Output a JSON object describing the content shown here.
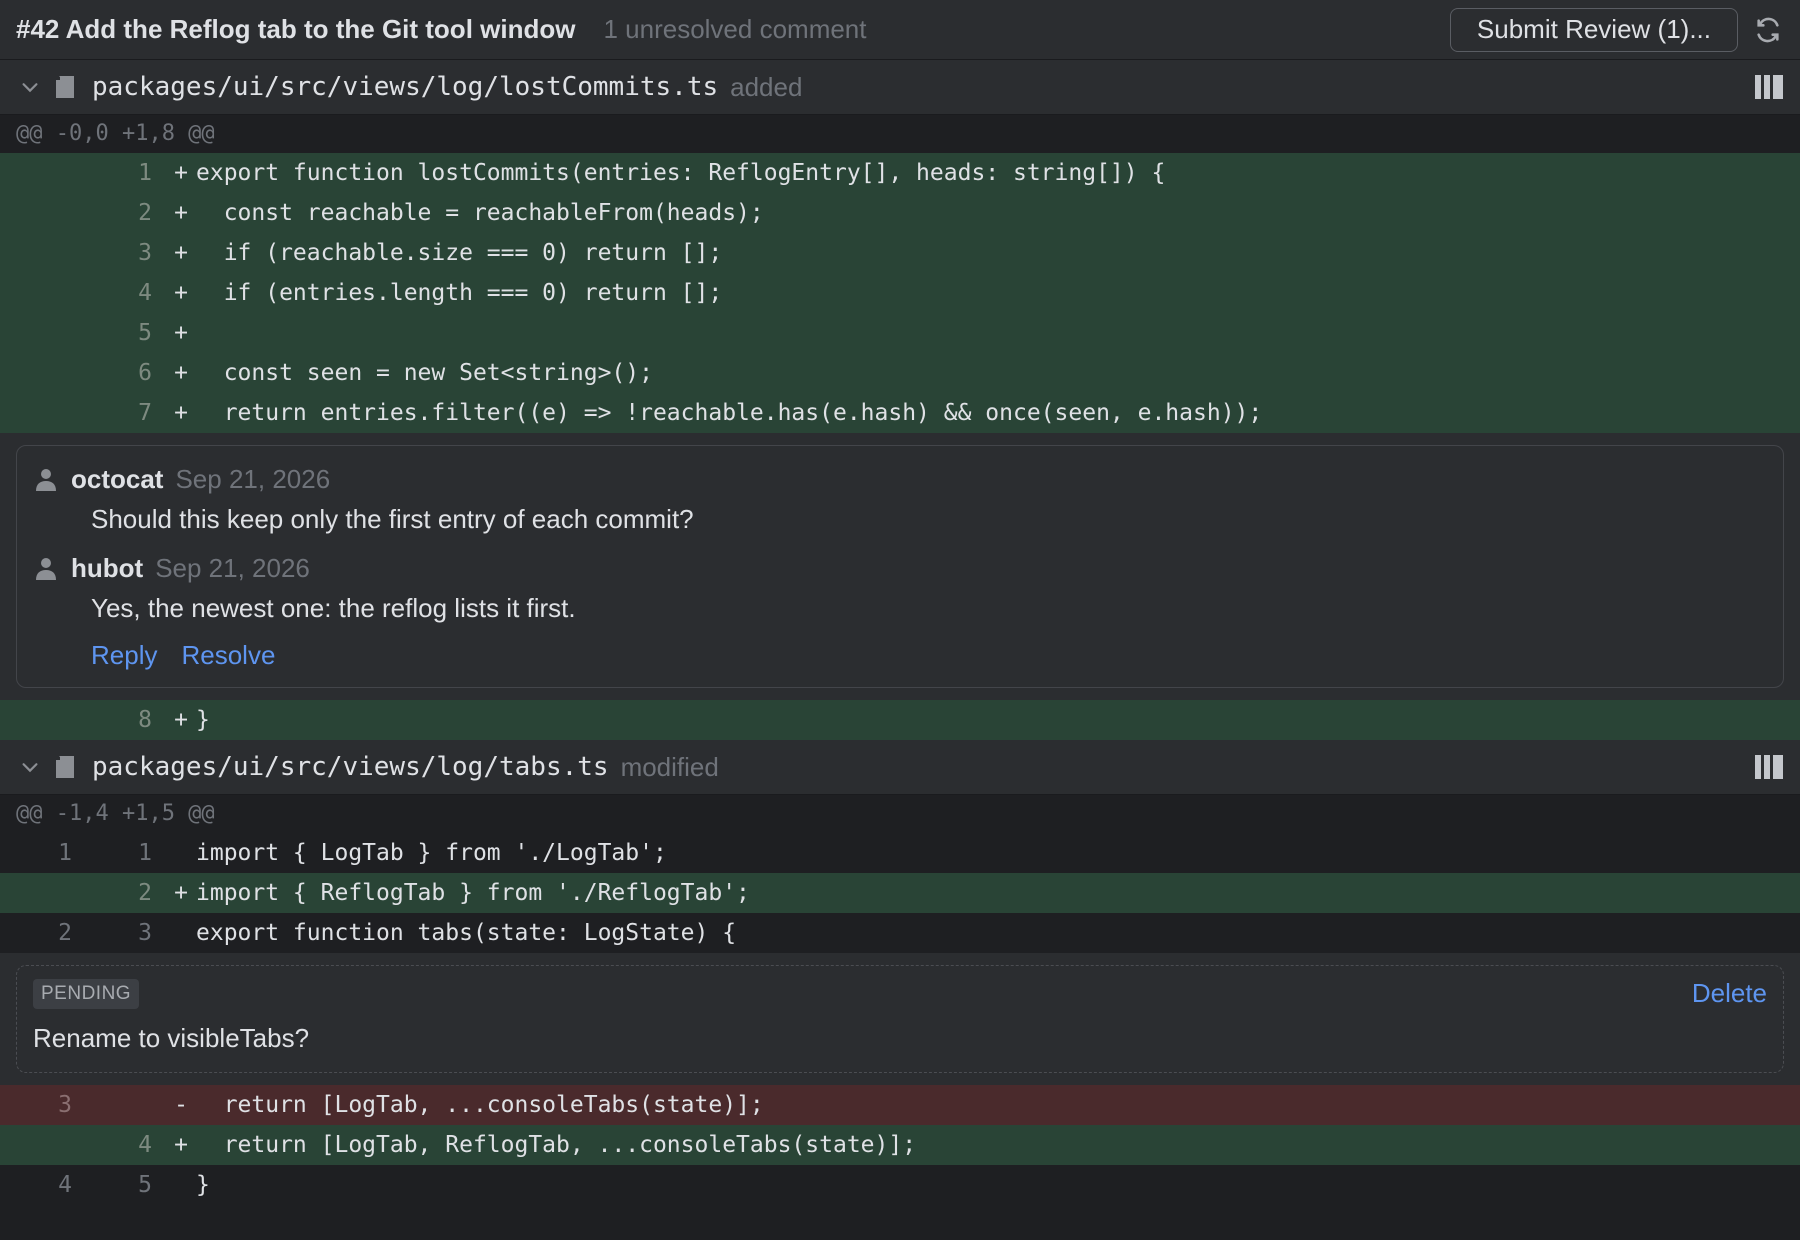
{
  "header": {
    "title": "#42 Add the Reflog tab to the Git tool window",
    "unresolved": "1 unresolved comment",
    "submit_label": "Submit Review (1)..."
  },
  "files": [
    {
      "path": "packages/ui/src/views/log/lostCommits.ts",
      "status": "added",
      "hunk": "@@ -0,0 +1,8 @@",
      "lines": [
        {
          "old": "",
          "new": "1",
          "marker": "+",
          "code": "export function lostCommits(entries: ReflogEntry[], heads: string[]) {",
          "type": "added"
        },
        {
          "old": "",
          "new": "2",
          "marker": "+",
          "code": "  const reachable = reachableFrom(heads);",
          "type": "added"
        },
        {
          "old": "",
          "new": "3",
          "marker": "+",
          "code": "  if (reachable.size === 0) return [];",
          "type": "added"
        },
        {
          "old": "",
          "new": "4",
          "marker": "+",
          "code": "  if (entries.length === 0) return [];",
          "type": "added"
        },
        {
          "old": "",
          "new": "5",
          "marker": "+",
          "code": "",
          "type": "added"
        },
        {
          "old": "",
          "new": "6",
          "marker": "+",
          "code": "  const seen = new Set<string>();",
          "type": "added"
        },
        {
          "old": "",
          "new": "7",
          "marker": "+",
          "code": "  return entries.filter((e) => !reachable.has(e.hash) && once(seen, e.hash));",
          "type": "added"
        }
      ],
      "after_thread": [
        {
          "old": "",
          "new": "8",
          "marker": "+",
          "code": "}",
          "type": "added"
        }
      ]
    },
    {
      "path": "packages/ui/src/views/log/tabs.ts",
      "status": "modified",
      "hunk": "@@ -1,4 +1,5 @@",
      "lines": [
        {
          "old": "1",
          "new": "1",
          "marker": "",
          "code": "import { LogTab } from './LogTab';",
          "type": "context"
        },
        {
          "old": "",
          "new": "2",
          "marker": "+",
          "code": "import { ReflogTab } from './ReflogTab';",
          "type": "added"
        },
        {
          "old": "2",
          "new": "3",
          "marker": "",
          "code": "export function tabs(state: LogState) {",
          "type": "context"
        }
      ],
      "after_pending": [
        {
          "old": "3",
          "new": "",
          "marker": "-",
          "code": "  return [LogTab, ...consoleTabs(state)];",
          "type": "removed"
        },
        {
          "old": "",
          "new": "4",
          "marker": "+",
          "code": "  return [LogTab, ReflogTab, ...consoleTabs(state)];",
          "type": "added"
        },
        {
          "old": "4",
          "new": "5",
          "marker": "",
          "code": "}",
          "type": "context"
        }
      ]
    }
  ],
  "thread": {
    "comments": [
      {
        "author": "octocat",
        "date": "Sep 21, 2026",
        "body": "Should this keep only the first entry of each commit?"
      },
      {
        "author": "hubot",
        "date": "Sep 21, 2026",
        "body": "Yes, the newest one: the reflog lists it first."
      }
    ],
    "reply_label": "Reply",
    "resolve_label": "Resolve"
  },
  "pending": {
    "badge": "PENDING",
    "delete_label": "Delete",
    "body": "Rename to visibleTabs?"
  },
  "colors": {
    "added_bg": "#294436",
    "removed_bg": "#4a2a2c",
    "link": "#5e95f0"
  }
}
